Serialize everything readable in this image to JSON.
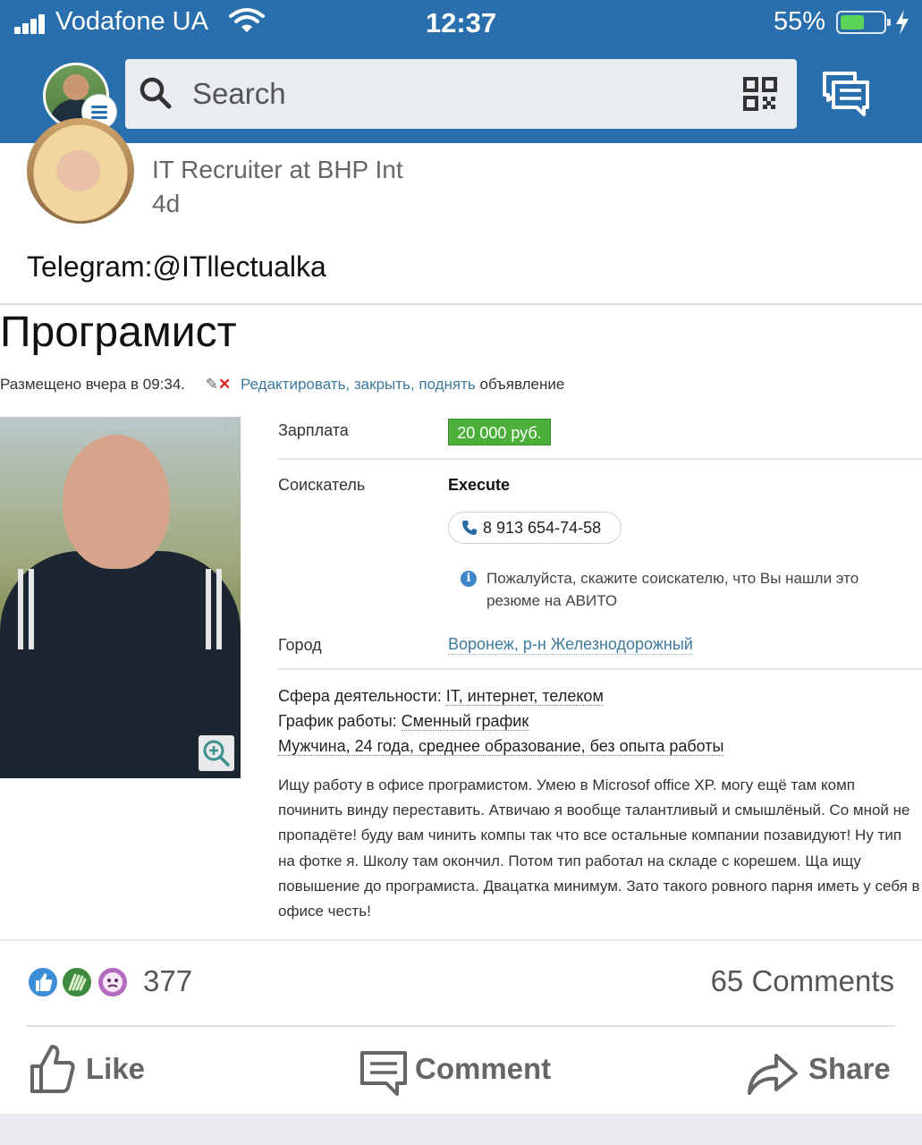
{
  "status_bar": {
    "carrier": "Vodafone UA",
    "time": "12:37",
    "battery_percent": "55%",
    "battery_level": 0.55
  },
  "top_nav": {
    "search_placeholder": "Search"
  },
  "post": {
    "author_headline": "IT Recruiter at BHP Int",
    "time_ago": "4d",
    "text": "Telegram:@ITllectualka"
  },
  "ad": {
    "title": "Програмист",
    "posted": "Размещено вчера в 09:34.",
    "edit_links": "Редактировать, закрыть, поднять",
    "edit_suffix": "объявление",
    "salary_label": "Зарплата",
    "salary_value": "20 000 руб.",
    "seeker_label": "Соискатель",
    "seeker_name": "Execute",
    "phone": "8 913 654-74-58",
    "notice": "Пожалуйста, скажите соискателю, что Вы нашли это резюме на АВИТО",
    "city_label": "Город",
    "city_value": "Воронеж, р-н Железнодорожный",
    "field_label": "Сфера деятельности:",
    "field_value": "IT, интернет, телеком",
    "schedule_label": "График работы:",
    "schedule_value": "Сменный график",
    "profile": "Мужчина, 24 года, среднее образование, без опыта работы",
    "description": "Ищу работу в офисе програмистом. Умею в Microsof office XP. могу ещё там комп починить винду переставить. Атвичаю я вообще талантливый и смышлёный. Со мной не пропадёте! буду вам чинить компы так что все остальные компании позавидуют! Ну тип на фотке я. Школу там окончил. Потом тип работал на складе с корешем. Ща ищу повышение до програмиста. Двацатка минимум. Зато такого ровного парня иметь у себя в офисе честь!"
  },
  "social": {
    "reaction_count": "377",
    "comments": "65 Comments",
    "like_label": "Like",
    "comment_label": "Comment",
    "share_label": "Share",
    "colors": {
      "like": "#3d8ed8",
      "celebrate": "#3e8a3e",
      "curious": "#b36bc0"
    }
  }
}
